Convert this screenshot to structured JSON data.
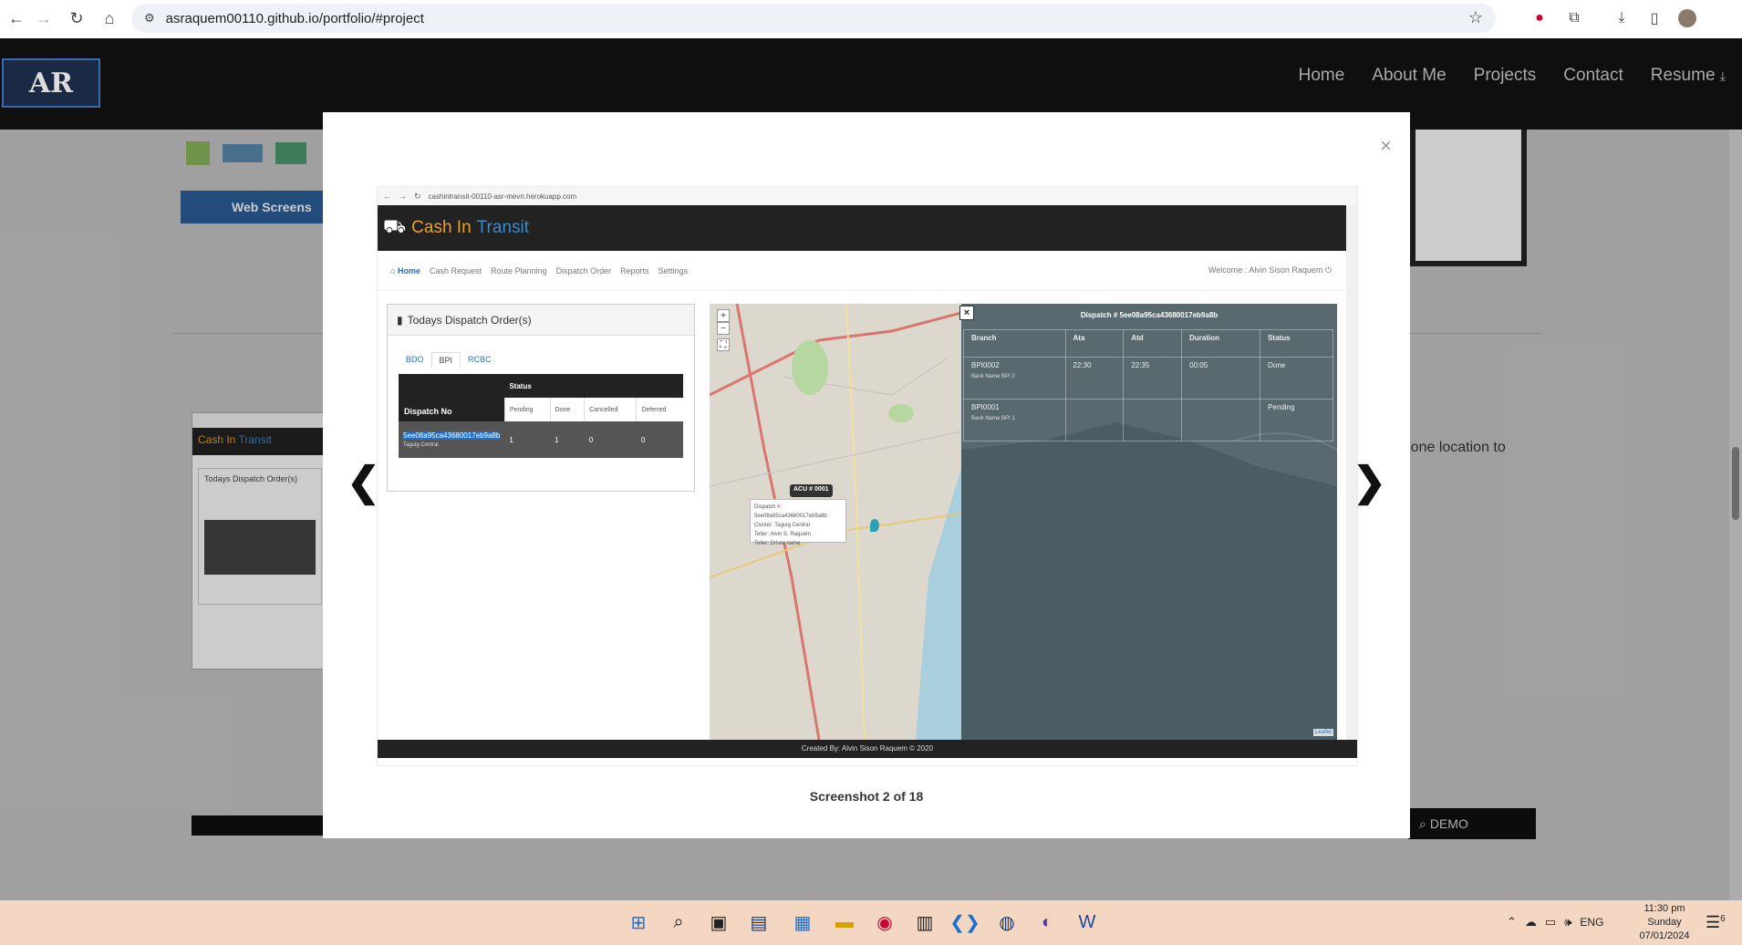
{
  "browser": {
    "url": "asraquem00110.github.io/portfolio/#project",
    "nav_icons": [
      "back-icon",
      "forward-icon",
      "reload-icon",
      "home-icon"
    ],
    "extension_icons": [
      "color-wheel-icon",
      "puzzle-icon",
      "download-icon",
      "sidebar-icon",
      "avatar"
    ]
  },
  "site": {
    "logo_text": "AR",
    "nav": [
      "Home",
      "About Me",
      "Projects",
      "Contact",
      "Resume"
    ],
    "background": {
      "web_screenshot_btn": "Web Screens",
      "desc_text": "om one location to",
      "demo_btn": "DEMO",
      "mini_app_title1": "Cash In",
      "mini_app_title2": "Transit",
      "mini_panel_title": "Todays Dispatch Order(s)"
    }
  },
  "modal": {
    "close": "×",
    "caption": "Screenshot 2 of 18",
    "prev_icon": "chevron-left-icon",
    "next_icon": "chevron-right-icon",
    "inner": {
      "url": "cashintransit-00110-asr-mevn.herokuapp.com",
      "app_title_a": "Cash In",
      "app_title_b": "Transit",
      "nav": [
        "Home",
        "Cash Request",
        "Route Planning",
        "Dispatch Order",
        "Reports",
        "Settings"
      ],
      "welcome": "Welcome : Alvin Sison Raquem",
      "panel_title": "Todays Dispatch Order(s)",
      "tabs": [
        "BDO",
        "BPI",
        "RCBC"
      ],
      "table": {
        "header_dispatch": "Dispatch No",
        "header_status": "Status",
        "status_cols": [
          "Pending",
          "Done",
          "Cancelled",
          "Deferred"
        ],
        "row": {
          "dispatch_no": "5ee08a95ca43680017eb9a8b",
          "cluster": "Taguig Central",
          "values": [
            "1",
            "1",
            "0",
            "0"
          ]
        }
      },
      "map": {
        "zoom_in": "+",
        "zoom_out": "−",
        "close": "×",
        "dispatch_title": "Dispatch # 5ee08a95ca43680017eb9a8b",
        "cols": [
          "Branch",
          "Ata",
          "Atd",
          "Duration",
          "Status"
        ],
        "rows": [
          {
            "branch": "BPI0002",
            "bank": "Bank Name BPI 2",
            "ata": "22:30",
            "atd": "22:35",
            "duration": "00:05",
            "status": "Done"
          },
          {
            "branch": "BPI0001",
            "bank": "Bank Name BPI 1",
            "ata": "",
            "atd": "",
            "duration": "",
            "status": "Pending"
          }
        ],
        "popup_label": "ACU # 0001",
        "popup_lines": [
          "Dispatch #: 5ee08a95ca43680017eb9a8b",
          "Cluster: Taguig Central",
          "Teller: Alvin S. Raquem",
          "Teller: Driver name"
        ],
        "attribution": "Leaflet"
      },
      "footer": "Created By: Alvin Sison Raquem © 2020"
    }
  },
  "taskbar": {
    "lang": "ENG",
    "time": "11:30 pm",
    "day": "Sunday",
    "date": "07/01/2024",
    "notif_count": "6"
  }
}
